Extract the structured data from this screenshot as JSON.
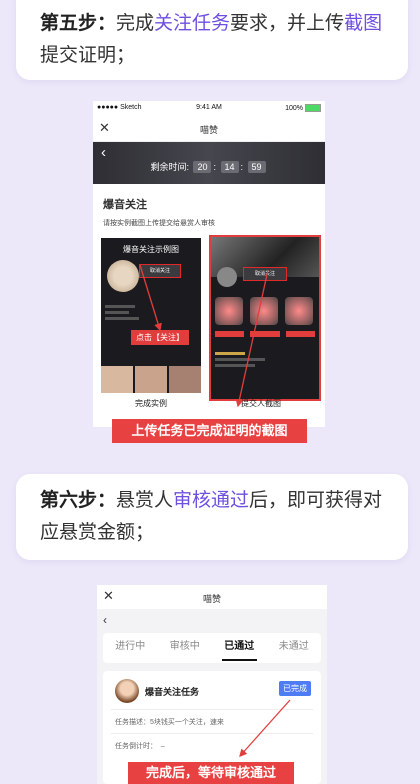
{
  "step5": {
    "prefix": "第五步：",
    "p1": "完成",
    "highlight": "关注任务",
    "p2": "要求，并上传",
    "highlight2": "截图",
    "p3": "提交证明；"
  },
  "shot1": {
    "status": {
      "carrier": "●●●●● Sketch",
      "time": "9:41 AM",
      "battery": "100%"
    },
    "nav_title": "喵赞",
    "timer_label": "剩余时间:",
    "timer": [
      "20",
      "14",
      "59"
    ],
    "task_title": "爆音关注",
    "task_desc": "请按实例截图上传提交给悬赏人审核",
    "example_title": "爆音关注示例图",
    "follow_btn": "取消关注",
    "click_hint": "点击【关注】",
    "caption_left": "完成实例",
    "caption_right": "提交人截图"
  },
  "banner1": "上传任务已完成证明的截图",
  "step6": {
    "prefix": "第六步：",
    "p1": "悬赏人",
    "highlight": "审核通过",
    "p2": "后，即可获得对应悬赏金额；"
  },
  "shot2": {
    "nav_title": "喵赞",
    "tabs": [
      "进行中",
      "审核中",
      "已通过",
      "未通过"
    ],
    "active_tab": "已通过",
    "task_name": "爆音关注任务",
    "badge": "已完成",
    "desc_label": "任务描述：",
    "desc_value": "5块钱买一个关注，速来",
    "countdown_label": "任务倒计时：",
    "countdown_value": "–"
  },
  "banner2": "完成后，等待审核通过",
  "colors": {
    "accent": "#6f4fe0",
    "banner_red": "#e84141",
    "badge_blue": "#4e7cf5"
  }
}
